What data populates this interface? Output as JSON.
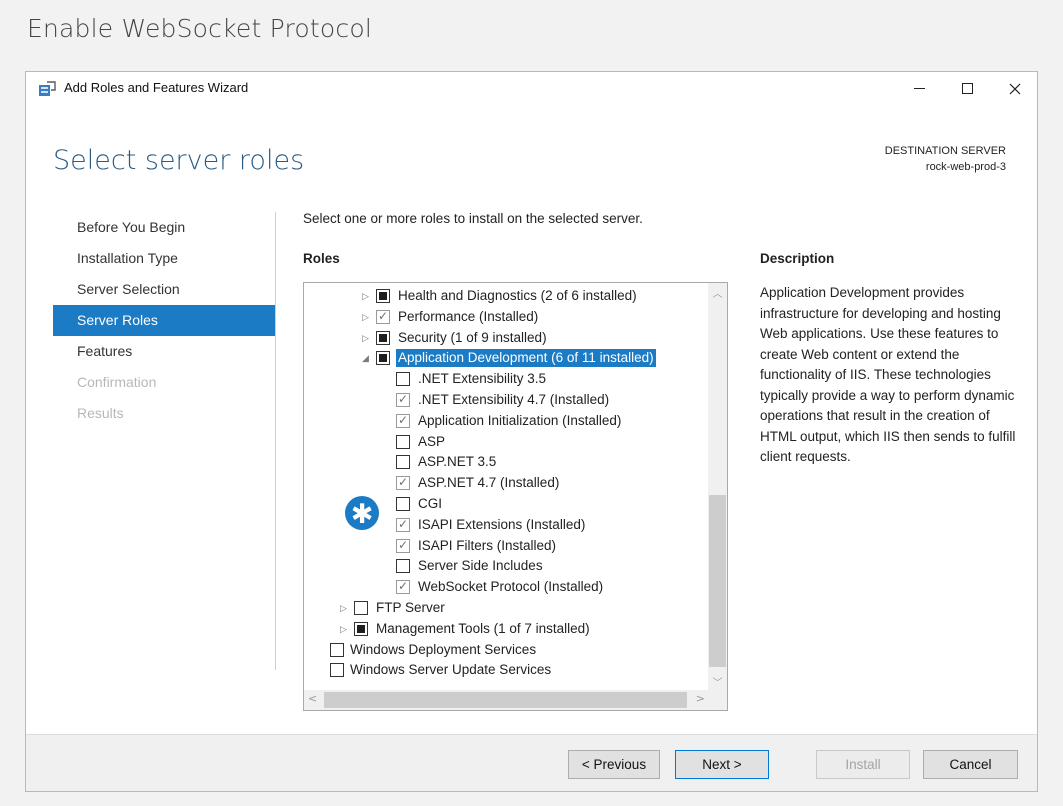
{
  "caption": "Enable WebSocket Protocol",
  "window": {
    "title": "Add Roles and Features Wizard"
  },
  "page_title": "Select server roles",
  "destination": {
    "label": "DESTINATION SERVER",
    "server": "rock-web-prod-3"
  },
  "nav": {
    "items": [
      {
        "label": "Before You Begin",
        "state": "normal"
      },
      {
        "label": "Installation Type",
        "state": "normal"
      },
      {
        "label": "Server Selection",
        "state": "normal"
      },
      {
        "label": "Server Roles",
        "state": "active"
      },
      {
        "label": "Features",
        "state": "normal"
      },
      {
        "label": "Confirmation",
        "state": "disabled"
      },
      {
        "label": "Results",
        "state": "disabled"
      }
    ]
  },
  "instruction": "Select one or more roles to install on the selected server.",
  "roles_heading": "Roles",
  "roles": [
    {
      "label": "Health and Diagnostics (2 of 6 installed)",
      "level": 2,
      "expander": "collapsed",
      "check": "partial"
    },
    {
      "label": "Performance (Installed)",
      "level": 2,
      "expander": "collapsed",
      "check": "checked"
    },
    {
      "label": "Security (1 of 9 installed)",
      "level": 2,
      "expander": "collapsed",
      "check": "partial"
    },
    {
      "label": "Application Development (6 of 11 installed)",
      "level": 2,
      "expander": "expanded",
      "check": "partial",
      "selected": true
    },
    {
      "label": ".NET Extensibility 3.5",
      "level": 3,
      "check": "unchecked"
    },
    {
      "label": ".NET Extensibility 4.7 (Installed)",
      "level": 3,
      "check": "checked"
    },
    {
      "label": "Application Initialization (Installed)",
      "level": 3,
      "check": "checked"
    },
    {
      "label": "ASP",
      "level": 3,
      "check": "unchecked"
    },
    {
      "label": "ASP.NET 3.5",
      "level": 3,
      "check": "unchecked"
    },
    {
      "label": "ASP.NET 4.7 (Installed)",
      "level": 3,
      "check": "checked"
    },
    {
      "label": "CGI",
      "level": 3,
      "check": "unchecked"
    },
    {
      "label": "ISAPI Extensions (Installed)",
      "level": 3,
      "check": "checked"
    },
    {
      "label": "ISAPI Filters (Installed)",
      "level": 3,
      "check": "checked"
    },
    {
      "label": "Server Side Includes",
      "level": 3,
      "check": "unchecked"
    },
    {
      "label": "WebSocket Protocol (Installed)",
      "level": 3,
      "check": "checked"
    },
    {
      "label": "FTP Server",
      "level": 1,
      "expander": "collapsed",
      "check": "unchecked"
    },
    {
      "label": "Management Tools (1 of 7 installed)",
      "level": 1,
      "expander": "collapsed",
      "check": "partial"
    },
    {
      "label": "Windows Deployment Services",
      "level": 0,
      "check": "unchecked"
    },
    {
      "label": "Windows Server Update Services",
      "level": 0,
      "check": "unchecked"
    }
  ],
  "description_heading": "Description",
  "description": "Application Development provides infrastructure for developing and hosting Web applications. Use these features to create Web content or extend the functionality of IIS. These technologies typically provide a way to perform dynamic operations that result in the creation of HTML output, which IIS then sends to fulfill client requests.",
  "badge_glyph": "✱",
  "buttons": {
    "previous": "< Previous",
    "next": "Next >",
    "install": "Install",
    "cancel": "Cancel"
  },
  "colors": {
    "accent": "#1b7bc4",
    "title": "#2a5b84"
  }
}
